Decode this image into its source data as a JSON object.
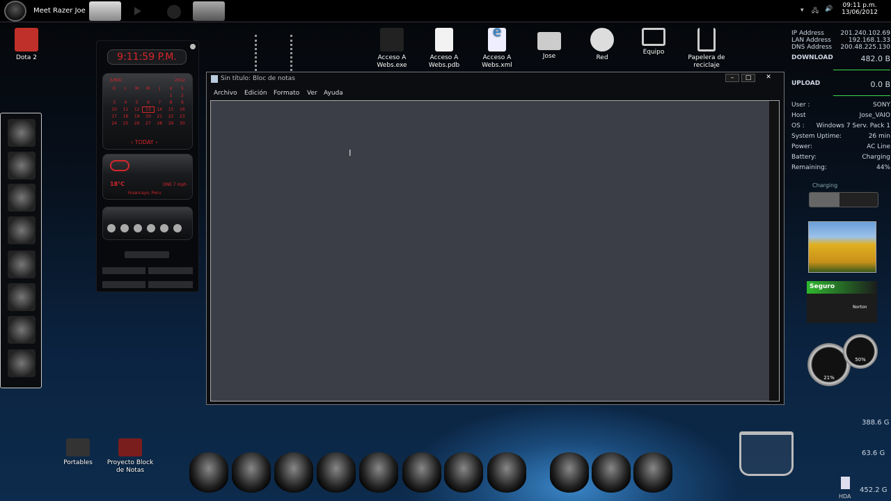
{
  "taskbar": {
    "title": "Meet Razer Joe",
    "time": "09:11 p.m.",
    "date": "13/06/2012"
  },
  "desktop_icons": [
    {
      "label": "Dota 2"
    },
    {
      "label": "Acceso A Webs.exe"
    },
    {
      "label": "Acceso A Webs.pdb"
    },
    {
      "label": "Acceso A Webs.xml"
    },
    {
      "label": "Jose"
    },
    {
      "label": "Red"
    },
    {
      "label": "Equipo"
    },
    {
      "label": "Papelera de reciclaje"
    },
    {
      "label": "Portables"
    },
    {
      "label": "Proyecto Block de Notas"
    }
  ],
  "gadget": {
    "clock": "9:11:59 P.M.",
    "month": "JUNIO",
    "year": "2012",
    "days": [
      "D",
      "L",
      "M",
      "M",
      "J",
      "V",
      "S"
    ],
    "dates": [
      "",
      "",
      "",
      "",
      "",
      "1",
      "2",
      "3",
      "4",
      "5",
      "6",
      "7",
      "8",
      "9",
      "10",
      "11",
      "12",
      "13",
      "14",
      "15",
      "16",
      "17",
      "18",
      "19",
      "20",
      "21",
      "22",
      "23",
      "24",
      "25",
      "26",
      "27",
      "28",
      "29",
      "30"
    ],
    "today_label": "TODAY",
    "temp": "18°C",
    "weather_info": "DNE 7 mph",
    "location": "Huancayo, Peru"
  },
  "notepad": {
    "title": "Sin título: Bloc de notas",
    "menu": [
      "Archivo",
      "Edición",
      "Formato",
      "Ver",
      "Ayuda"
    ],
    "content": ""
  },
  "system": {
    "ip_label": "IP Address",
    "ip": "201.240.102.69",
    "lan_label": "LAN Address",
    "lan": "192.168.1.33",
    "dns_label": "DNS Address",
    "dns": "200.48.225.130",
    "download_label": "DOWNLOAD",
    "download": "482.0 B",
    "upload_label": "UPLOAD",
    "upload": "0.0 B",
    "rows": [
      [
        "User :",
        "SONY"
      ],
      [
        "Host",
        "Jose_VAIO"
      ],
      [
        "OS :",
        "Windows 7 Serv. Pack 1"
      ],
      [
        "System Uptime:",
        "26 min"
      ],
      [
        "Power:",
        "AC Line"
      ],
      [
        "Battery:",
        "Charging"
      ],
      [
        "Remaining:",
        "44%"
      ]
    ]
  },
  "battery": {
    "label": "Charging",
    "percent": 44,
    "percent_text": "44%"
  },
  "norton": {
    "status": "Seguro",
    "brand": "Norton"
  },
  "gauges": {
    "cpu": "21%",
    "ram": "50%"
  },
  "drives": {
    "d1": "388.6 G",
    "d2": "63.6 G",
    "d3": "452.2 G",
    "hda": "HDA"
  },
  "colors": {
    "accent_red": "#d8262b",
    "norton_green": "#2fb82f",
    "graph_green": "#3ddc4a"
  }
}
